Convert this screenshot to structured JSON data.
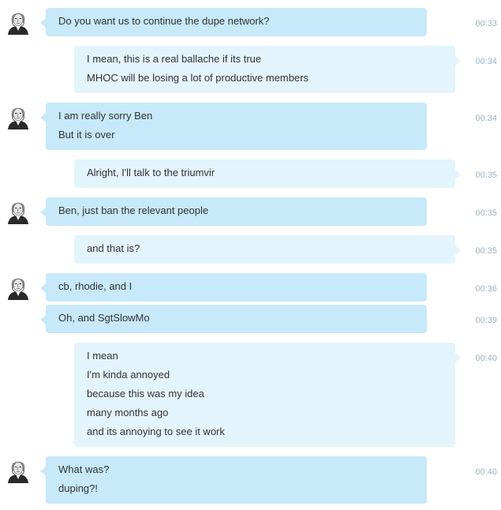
{
  "messages": [
    {
      "side": "in",
      "avatar": true,
      "lines": [
        "Do you want us to continue the dupe network?"
      ],
      "time": "00:33"
    },
    {
      "side": "out",
      "avatar": false,
      "lines": [
        "I mean, this is a real ballache if its true",
        "MHOC will be losing a lot of productive members"
      ],
      "time": "00:34"
    },
    {
      "side": "in",
      "avatar": true,
      "lines": [
        "I am really sorry Ben",
        "But it is over"
      ],
      "time": "00:34"
    },
    {
      "side": "out",
      "avatar": false,
      "lines": [
        "Alright, I'll talk to the triumvir"
      ],
      "time": "00:35"
    },
    {
      "side": "in",
      "avatar": true,
      "lines": [
        "Ben, just ban the relevant people"
      ],
      "time": "00:35"
    },
    {
      "side": "out",
      "avatar": false,
      "lines": [
        "and that is?"
      ],
      "time": "00:35"
    },
    {
      "side": "in",
      "avatar": true,
      "lines": [
        "cb, rhodie, and I"
      ],
      "time": "00:36"
    },
    {
      "side": "in",
      "avatar": false,
      "lines": [
        "Oh, and SgtSlowMo"
      ],
      "time": "00:39"
    },
    {
      "side": "out",
      "avatar": false,
      "lines": [
        "I mean",
        "I'm kinda annoyed",
        "because this was my idea",
        "many months ago",
        "and its annoying to see it work"
      ],
      "time": "00:40"
    },
    {
      "side": "in",
      "avatar": true,
      "lines": [
        "What was?",
        "duping?!"
      ],
      "time": "00:40"
    }
  ]
}
